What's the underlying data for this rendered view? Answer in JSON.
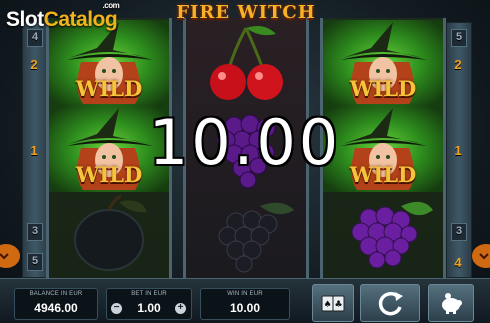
{
  "logo": {
    "brand_left": "Slot",
    "brand_right": "Catalog",
    "suffix": ".com"
  },
  "game": {
    "title": "FIRE WITCH"
  },
  "paylines": {
    "left": [
      "4",
      "2",
      "1",
      "3",
      "5"
    ],
    "right": [
      "5",
      "2",
      "1",
      "3",
      "4"
    ]
  },
  "reels": [
    [
      "witch-wild",
      "witch-wild",
      "plum"
    ],
    [
      "cherries",
      "grapes",
      "grapes"
    ],
    [
      "witch-wild",
      "witch-wild",
      "grapes"
    ]
  ],
  "symbols": {
    "wild_label": "WILD"
  },
  "win": {
    "amount": "10.00"
  },
  "footer": {
    "balance_label": "BALANCE IN EUR",
    "balance_value": "4946.00",
    "bet_label": "BET IN EUR",
    "bet_value": "1.00",
    "win_label": "WIN IN EUR",
    "win_value": "10.00",
    "minus": "−",
    "plus": "+"
  },
  "colors": {
    "accent": "#f1b31c",
    "wild_glow": "#6bd23b",
    "title": "#f7b225"
  }
}
